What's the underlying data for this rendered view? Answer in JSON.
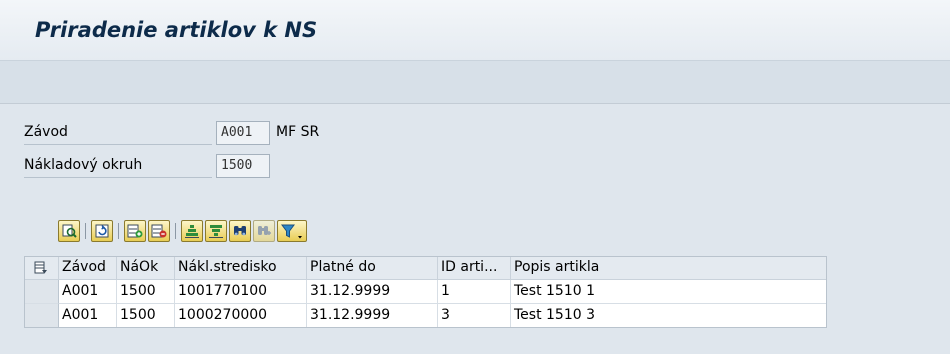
{
  "window": {
    "title": "Priradenie artiklov k NS"
  },
  "form": {
    "plant_label": "Závod",
    "plant_value": "A001",
    "plant_desc": "MF SR",
    "area_label": "Nákladový okruh",
    "area_value": "1500"
  },
  "toolbar": {
    "icons": [
      "details-icon",
      "refresh-icon",
      "insert-row-icon",
      "delete-row-icon",
      "sort-ascending-icon",
      "sort-descending-icon",
      "find-icon",
      "find-next-icon",
      "filter-icon"
    ]
  },
  "table": {
    "columns": [
      "Závod",
      "NáOk",
      "Nákl.stredisko",
      "Platné do",
      "ID arti...",
      "Popis artikla"
    ],
    "rows": [
      [
        "A001",
        "1500",
        "1001770100",
        "31.12.9999",
        "1",
        "Test 1510 1"
      ],
      [
        "A001",
        "1500",
        "1000270000",
        "31.12.9999",
        "3",
        "Test 1510 3"
      ]
    ]
  }
}
